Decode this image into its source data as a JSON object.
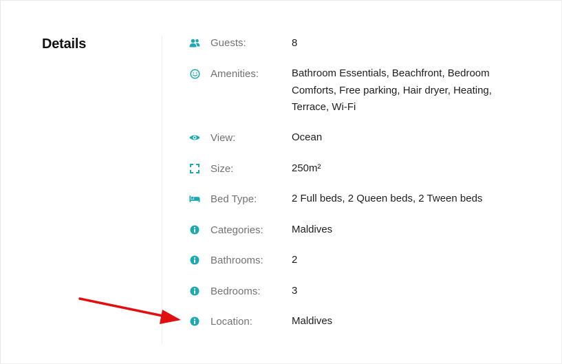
{
  "section": {
    "title": "Details"
  },
  "accent_color": "#1ba9b3",
  "annotation_color": "#e01010",
  "details": [
    {
      "icon": "guests-icon",
      "label": "Guests:",
      "value": "8"
    },
    {
      "icon": "smile-icon",
      "label": "Amenities:",
      "value": "Bathroom Essentials, Beachfront, Bedroom Comforts, Free parking, Hair dryer, Heating, Terrace, Wi-Fi"
    },
    {
      "icon": "eye-icon",
      "label": "View:",
      "value": "Ocean"
    },
    {
      "icon": "size-icon",
      "label": "Size:",
      "value": "250m²"
    },
    {
      "icon": "bed-icon",
      "label": "Bed Type:",
      "value": "2 Full beds, 2 Queen beds, 2 Tween beds"
    },
    {
      "icon": "info-icon",
      "label": "Categories:",
      "value": "Maldives"
    },
    {
      "icon": "info-icon",
      "label": "Bathrooms:",
      "value": "2"
    },
    {
      "icon": "info-icon",
      "label": "Bedrooms:",
      "value": "3"
    },
    {
      "icon": "info-icon",
      "label": "Location:",
      "value": "Maldives"
    }
  ]
}
